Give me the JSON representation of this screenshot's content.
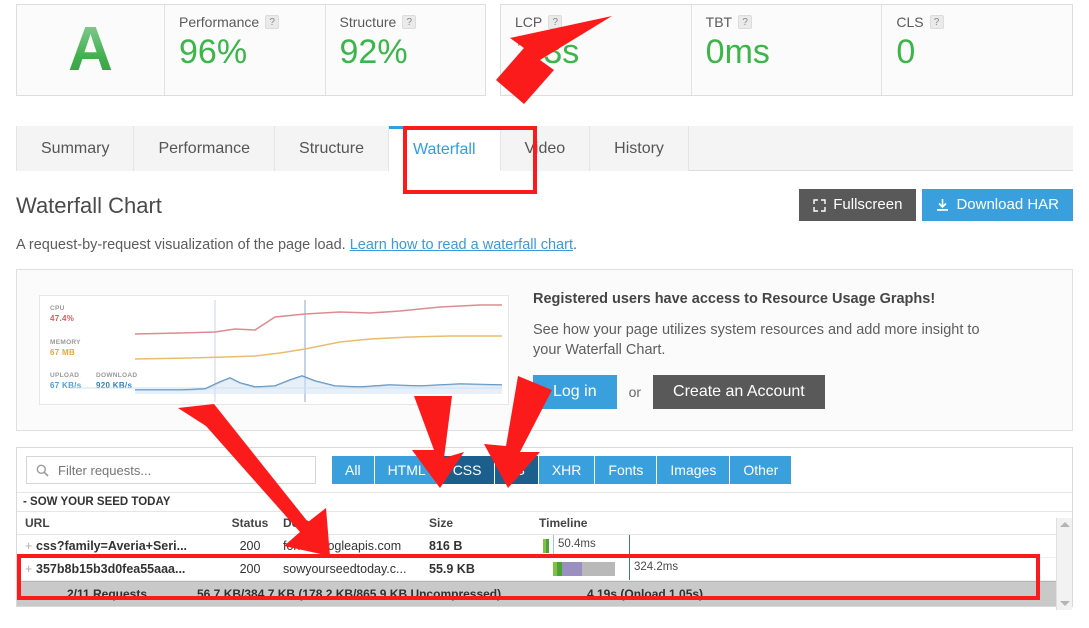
{
  "scorecard": {
    "grade": "A",
    "metrics": [
      {
        "label": "Performance",
        "help": "?",
        "value": "96%"
      },
      {
        "label": "Structure",
        "help": "?",
        "value": "92%"
      },
      {
        "label": "LCP",
        "help": "?",
        "value": "1.3s"
      },
      {
        "label": "TBT",
        "help": "?",
        "value": "0ms"
      },
      {
        "label": "CLS",
        "help": "?",
        "value": "0"
      }
    ]
  },
  "tabs": [
    {
      "label": "Summary",
      "active": false
    },
    {
      "label": "Performance",
      "active": false
    },
    {
      "label": "Structure",
      "active": false
    },
    {
      "label": "Waterfall",
      "active": true
    },
    {
      "label": "Video",
      "active": false
    },
    {
      "label": "History",
      "active": false
    }
  ],
  "header": {
    "title": "Waterfall Chart",
    "fullscreen_label": "Fullscreen",
    "download_label": "Download HAR",
    "subtitle_text": "A request-by-request visualization of the page load.",
    "subtitle_link": "Learn how to read a waterfall chart",
    "subtitle_end": "."
  },
  "promo": {
    "heading": "Registered users have access to Resource Usage Graphs!",
    "body": "See how your page utilizes system resources and add more insight to your Waterfall Chart.",
    "login_label": "Log in",
    "or_label": "or",
    "create_label": "Create an Account",
    "graph": {
      "cpu_label": "CPU",
      "cpu_value": "47.4%",
      "memory_label": "MEMORY",
      "memory_value": "67 MB",
      "upload_label": "UPLOAD",
      "upload_value": "67 KB/s",
      "download_label": "DOWNLOAD",
      "download_value": "920 KB/s"
    }
  },
  "filters": {
    "search_placeholder": "Filter requests...",
    "search_value": "",
    "chips": [
      {
        "label": "All",
        "selected": false
      },
      {
        "label": "HTML",
        "selected": false
      },
      {
        "label": "CSS",
        "selected": true
      },
      {
        "label": "JS",
        "selected": true
      },
      {
        "label": "XHR",
        "selected": false
      },
      {
        "label": "Fonts",
        "selected": false
      },
      {
        "label": "Images",
        "selected": false
      },
      {
        "label": "Other",
        "selected": false
      }
    ]
  },
  "table": {
    "group_label": "- SOW YOUR SEED TODAY",
    "columns": [
      "URL",
      "Status",
      "Domain",
      "Size",
      "Timeline"
    ],
    "rows": [
      {
        "url": "css?family=Averia+Seri...",
        "status": "200",
        "domain": "fonts.googleapis.com",
        "size": "816 B",
        "time_label": "50.4ms"
      },
      {
        "url": "357b8b15b3d0fea55aaa...",
        "status": "200",
        "domain": "sowyourseedtoday.c...",
        "size": "55.9 KB",
        "time_label": "324.2ms"
      }
    ]
  },
  "footer": {
    "requests": "2/11 Requests",
    "sizes": "56.7 KB/384.7 KB  (178.2 KB/865.9 KB Uncompressed)",
    "timing": "4.19s  (Onload 1.05s)"
  },
  "colors": {
    "accent_blue": "#3aa0dd",
    "green": "#3cb54a",
    "annotation_red": "#fc1b1b",
    "chip_selected": "#1c5f8c"
  }
}
